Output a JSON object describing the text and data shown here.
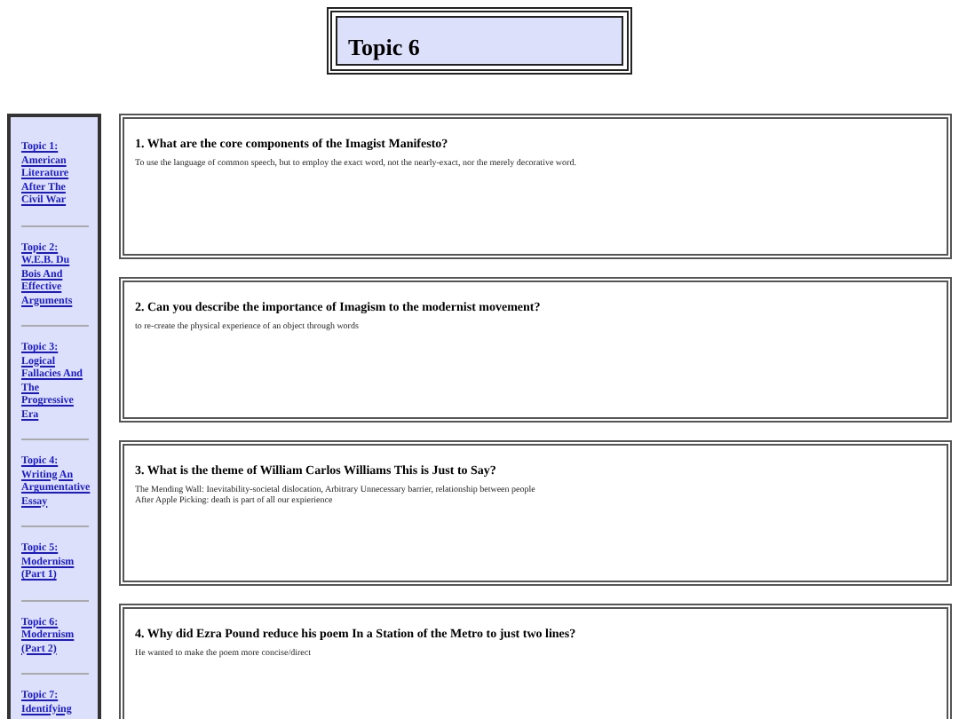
{
  "header": {
    "title": "Topic 6"
  },
  "sidebar": {
    "items": [
      {
        "label": "Topic 1: American Literature After The Civil War"
      },
      {
        "label": "Topic 2: W.E.B. Du Bois And Effective Arguments"
      },
      {
        "label": "Topic 3: Logical Fallacies And The Progressive Era"
      },
      {
        "label": "Topic 4: Writing An Argumentative Essay"
      },
      {
        "label": "Topic 5: Modernism (Part 1)"
      },
      {
        "label": "Topic 6: Modernism (Part 2)"
      },
      {
        "label": "Topic 7: Identifying"
      }
    ]
  },
  "questions": [
    {
      "question": "1. What are the core components of the Imagist Manifesto?",
      "answer_lines": [
        "To use the language of common speech, but to employ the exact word, not the nearly-exact, nor the merely decorative word."
      ]
    },
    {
      "question": "2. Can you describe the importance of Imagism to the modernist movement?",
      "answer_lines": [
        "to re-create the physical experience of an object through words"
      ]
    },
    {
      "question": "3. What is the theme of William Carlos Williams This is Just to Say?",
      "answer_lines": [
        "The Mending Wall: Inevitability-societal dislocation, Arbitrary Unnecessary barrier, relationship between people",
        "After Apple Picking: death is part of all our expierience"
      ]
    },
    {
      "question": "4. Why did Ezra Pound reduce his poem In a Station of the Metro to just two lines?",
      "answer_lines": [
        "He wanted to make the poem more concise/direct"
      ]
    }
  ]
}
